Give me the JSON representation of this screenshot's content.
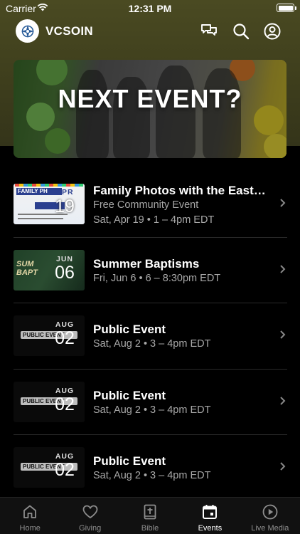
{
  "status_bar": {
    "carrier": "Carrier",
    "time": "12:31 PM"
  },
  "app_bar": {
    "brand": "VCSOIN"
  },
  "hero": {
    "title": "NEXT EVENT?"
  },
  "events": [
    {
      "title": "Family Photos with the Easter...",
      "subtitle": "Free Community Event",
      "date_line": "Sat, Apr 19 • 1 – 4pm EDT",
      "thumb_month": "APR",
      "thumb_day": "19"
    },
    {
      "title": "Summer Baptisms",
      "subtitle": "",
      "date_line": "Fri, Jun 6 • 6 – 8:30pm EDT",
      "thumb_month": "JUN",
      "thumb_day": "06"
    },
    {
      "title": "Public Event",
      "subtitle": "",
      "date_line": "Sat, Aug 2 • 3 – 4pm EDT",
      "thumb_month": "AUG",
      "thumb_day": "02"
    },
    {
      "title": "Public Event",
      "subtitle": "",
      "date_line": "Sat, Aug 2 • 3 – 4pm EDT",
      "thumb_month": "AUG",
      "thumb_day": "02"
    },
    {
      "title": "Public Event",
      "subtitle": "",
      "date_line": "Sat, Aug 2 • 3 – 4pm EDT",
      "thumb_month": "AUG",
      "thumb_day": "02"
    }
  ],
  "tab_bar": {
    "active": "events",
    "tabs": [
      {
        "id": "home",
        "label": "Home",
        "icon": "home-icon"
      },
      {
        "id": "giving",
        "label": "Giving",
        "icon": "heart-icon"
      },
      {
        "id": "bible",
        "label": "Bible",
        "icon": "bible-icon"
      },
      {
        "id": "events",
        "label": "Events",
        "icon": "calendar-icon"
      },
      {
        "id": "live_media",
        "label": "Live Media",
        "icon": "play-circle-icon"
      }
    ]
  },
  "colors": {
    "header_bg": "#3d3d1c",
    "background": "#000000",
    "subtext": "#a8a8a8",
    "tab_inactive": "#8e8e8e"
  }
}
